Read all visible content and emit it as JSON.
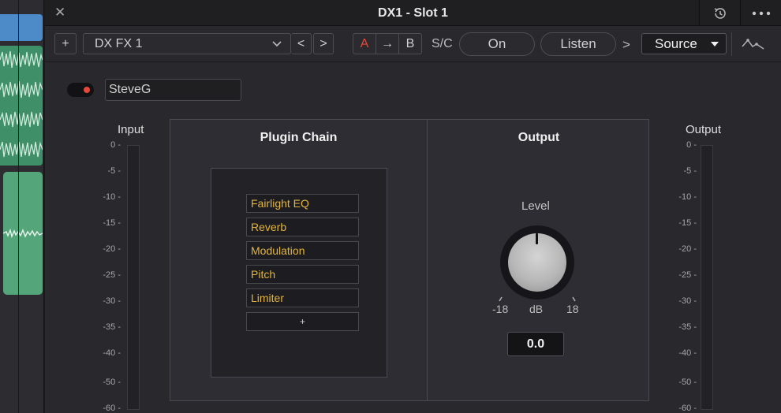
{
  "window": {
    "title": "DX1 - Slot 1",
    "close_glyph": "✕",
    "history_icon": "history-icon",
    "more_icon": "more-horizontal-icon"
  },
  "toolbar": {
    "add_glyph": "+",
    "preset": "DX FX 1",
    "prev_glyph": "<",
    "next_glyph": ">",
    "ab": {
      "a": "A",
      "copy": "→",
      "b": "B"
    },
    "sidechain_label": "S/C",
    "on_label": "On",
    "listen_label": "Listen",
    "chevron_glyph": ">",
    "source_label": "Source",
    "curve_icon": "waveform-curve-icon"
  },
  "instance": {
    "name": "SteveG",
    "enabled": true
  },
  "meters": {
    "input_label": "Input",
    "output_label": "Output",
    "scale": [
      "0",
      "-5",
      "-10",
      "-15",
      "-20",
      "-25",
      "-30",
      "-35",
      "-40",
      "-50",
      "-60"
    ]
  },
  "plugin_chain": {
    "title": "Plugin Chain",
    "items": [
      "Fairlight EQ",
      "Reverb",
      "Modulation",
      "Pitch",
      "Limiter"
    ],
    "add_label": "+"
  },
  "output": {
    "title": "Output",
    "level_label": "Level",
    "min": "-18",
    "unit": "dB",
    "max": "18",
    "value": "0.0"
  },
  "colors": {
    "accent_red": "#e8483a",
    "chain_text": "#e2b43c"
  }
}
